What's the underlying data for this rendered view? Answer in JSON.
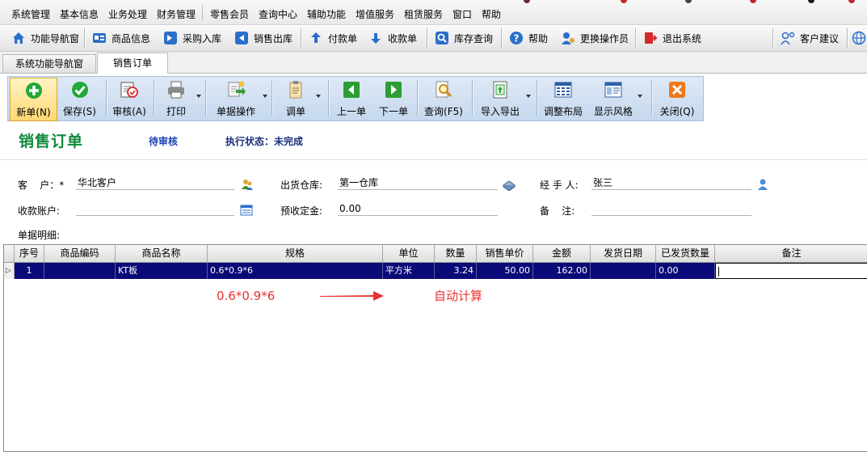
{
  "menu": [
    "系统管理",
    "基本信息",
    "业务处理",
    "财务管理",
    "零售会员",
    "查询中心",
    "辅助功能",
    "增值服务",
    "租赁服务",
    "窗口",
    "帮助"
  ],
  "quickbar": [
    {
      "label": "功能导航窗",
      "icon": "home-icon"
    },
    {
      "label": "商品信息",
      "icon": "goods-info-icon"
    },
    {
      "label": "采购入库",
      "icon": "purchase-in-icon"
    },
    {
      "label": "销售出库",
      "icon": "sales-out-icon"
    },
    {
      "label": "付款单",
      "icon": "payment-icon"
    },
    {
      "label": "收款单",
      "icon": "receipt-icon"
    },
    {
      "label": "库存查询",
      "icon": "inventory-search-icon"
    },
    {
      "label": "帮助",
      "icon": "help-icon"
    },
    {
      "label": "更换操作员",
      "icon": "change-operator-icon"
    },
    {
      "label": "退出系统",
      "icon": "exit-icon"
    },
    {
      "label": "客户建议",
      "icon": "feedback-icon"
    }
  ],
  "tabs": [
    "系统功能导航窗",
    "销售订单"
  ],
  "toolbar": [
    {
      "label": "新单(N)",
      "icon": "new-icon"
    },
    {
      "label": "保存(S)",
      "icon": "save-icon"
    },
    {
      "label": "审核(A)",
      "icon": "audit-icon"
    },
    {
      "label": "打印",
      "icon": "print-icon"
    },
    {
      "label": "单据操作",
      "icon": "document-ops-icon"
    },
    {
      "label": "调单",
      "icon": "load-document-icon"
    },
    {
      "label": "上一单",
      "icon": "previous-icon"
    },
    {
      "label": "下一单",
      "icon": "next-icon"
    },
    {
      "label": "查询(F5)",
      "icon": "query-icon"
    },
    {
      "label": "导入导出",
      "icon": "import-export-icon"
    },
    {
      "label": "调整布局",
      "icon": "layout-icon"
    },
    {
      "label": "显示风格",
      "icon": "style-icon"
    },
    {
      "label": "关闭(Q)",
      "icon": "close-icon"
    }
  ],
  "header": {
    "title": "销售订单",
    "audit_status": "待审核",
    "exec_status": "执行状态：未完成"
  },
  "form": {
    "customer_label": "客    户：*",
    "customer_value": "华北客户",
    "warehouse_label": "出货仓库:",
    "warehouse_value": "第一仓库",
    "handler_label": "经 手 人:",
    "handler_value": "张三",
    "account_label": "收款账户:",
    "account_value": "",
    "deposit_label": "预收定金:",
    "deposit_value": "0.00",
    "remark_label": "备    注:",
    "remark_value": "",
    "details_label": "单据明细:"
  },
  "grid": {
    "columns": [
      "序号",
      "商品编码",
      "商品名称",
      "规格",
      "单位",
      "数量",
      "销售单价",
      "金额",
      "发货日期",
      "已发货数量",
      "备注"
    ],
    "rows": [
      [
        "1",
        "",
        "KT板",
        "0.6*0.9*6",
        "平方米",
        "3.24",
        "50.00",
        "162.00",
        "",
        "0.00",
        ""
      ]
    ]
  },
  "annotations": {
    "spec": "0.6*0.9*6",
    "auto": "自动计算"
  }
}
